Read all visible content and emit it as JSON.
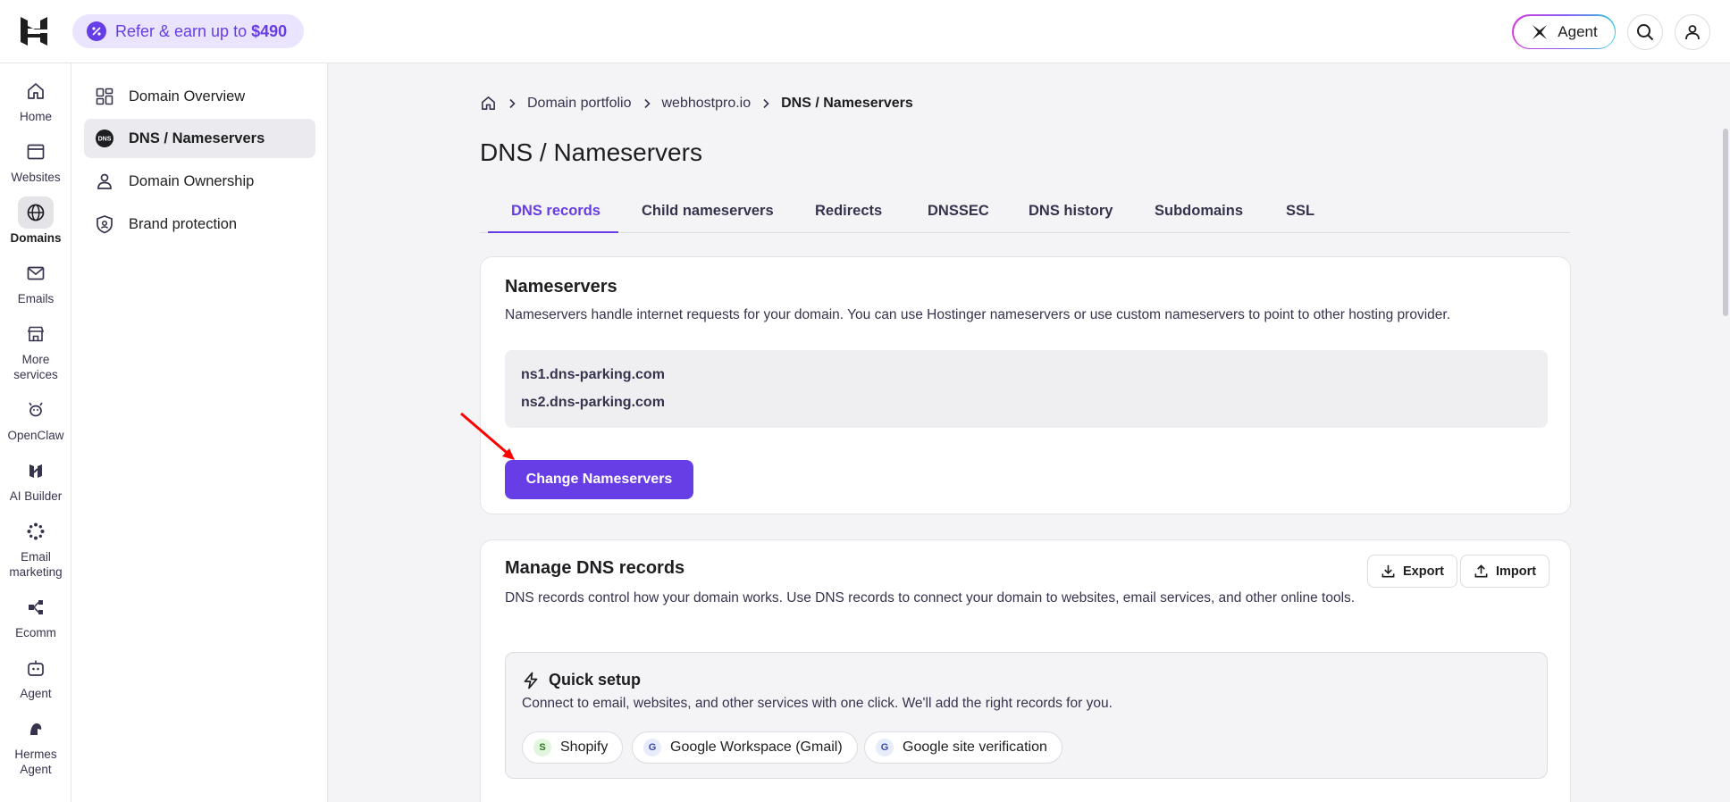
{
  "topbar": {
    "refer_text": "Refer & earn up to ",
    "refer_amount": "$490",
    "agent_label": "Agent"
  },
  "rail": [
    {
      "label": "Home",
      "icon": "home-icon"
    },
    {
      "label": "Websites",
      "icon": "browser-icon"
    },
    {
      "label": "Domains",
      "icon": "globe-icon",
      "active": true
    },
    {
      "label": "Emails",
      "icon": "mail-icon"
    },
    {
      "label": "More services",
      "icon": "store-icon"
    },
    {
      "label": "OpenClaw",
      "icon": "claw-icon"
    },
    {
      "label": "AI Builder",
      "icon": "ai-builder-icon"
    },
    {
      "label": "Email marketing",
      "icon": "sparkle-icon"
    },
    {
      "label": "Ecomm",
      "icon": "ecomm-icon"
    },
    {
      "label": "Agent",
      "icon": "robot-icon"
    },
    {
      "label": "Hermes Agent",
      "icon": "hermes-icon"
    }
  ],
  "subnav": [
    {
      "label": "Domain Overview",
      "icon": "grid-icon"
    },
    {
      "label": "DNS / Nameservers",
      "icon": "dns-icon",
      "active": true
    },
    {
      "label": "Domain Ownership",
      "icon": "person-icon"
    },
    {
      "label": "Brand protection",
      "icon": "shield-icon"
    }
  ],
  "breadcrumb": {
    "items": [
      "Domain portfolio",
      "webhostpro.io"
    ],
    "current": "DNS / Nameservers"
  },
  "page_title": "DNS / Nameservers",
  "tabs": [
    "DNS records",
    "Child nameservers",
    "Redirects",
    "DNSSEC",
    "DNS history",
    "Subdomains",
    "SSL"
  ],
  "nameservers": {
    "title": "Nameservers",
    "description": "Nameservers handle internet requests for your domain. You can use Hostinger nameservers or use custom nameservers to point to other hosting provider.",
    "ns1": "ns1.dns-parking.com",
    "ns2": "ns2.dns-parking.com",
    "button": "Change Nameservers"
  },
  "dns_records": {
    "title": "Manage DNS records",
    "description": "DNS records control how your domain works. Use DNS records to connect your domain to websites, email services, and other online tools.",
    "export": "Export",
    "import": "Import",
    "quick_setup": {
      "title": "Quick setup",
      "description": "Connect to email, websites, and other services with one click. We'll add the right records for you.",
      "chips": [
        {
          "letter": "S",
          "label": "Shopify"
        },
        {
          "letter": "G",
          "label": "Google Workspace (Gmail)"
        },
        {
          "letter": "G",
          "label": "Google site verification"
        }
      ]
    }
  },
  "colors": {
    "accent": "#673de6",
    "annotation_arrow": "#ff0000"
  }
}
